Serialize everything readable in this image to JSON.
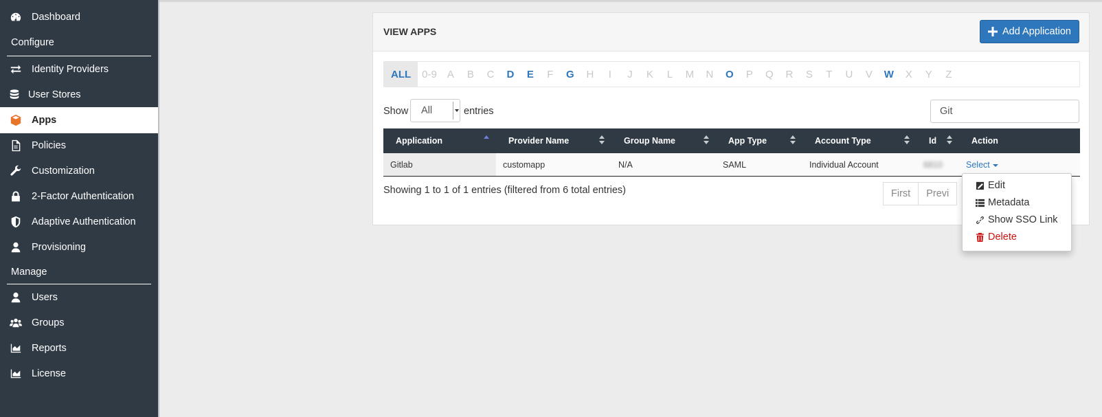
{
  "sidebar": {
    "items": [
      {
        "label": "Dashboard",
        "icon": "dashboard-icon"
      },
      {
        "label": "Identity Providers",
        "icon": "exchange-icon"
      },
      {
        "label": "User Stores",
        "icon": "database-icon"
      },
      {
        "label": "Apps",
        "icon": "cube-icon",
        "active": true
      },
      {
        "label": "Policies",
        "icon": "document-icon"
      },
      {
        "label": "Customization",
        "icon": "wrench-icon"
      },
      {
        "label": "2-Factor Authentication",
        "icon": "lock-icon"
      },
      {
        "label": "Adaptive Authentication",
        "icon": "shield-icon"
      },
      {
        "label": "Provisioning",
        "icon": "user-icon"
      },
      {
        "label": "Users",
        "icon": "user-icon"
      },
      {
        "label": "Groups",
        "icon": "users-icon"
      },
      {
        "label": "Reports",
        "icon": "area-chart-icon"
      },
      {
        "label": "License",
        "icon": "area-chart-icon"
      }
    ],
    "sections": {
      "configure": "Configure",
      "manage": "Manage"
    }
  },
  "panel": {
    "title": "VIEW APPS",
    "add_button": "Add Application",
    "alpha_filter": [
      "ALL",
      "0-9",
      "A",
      "B",
      "C",
      "D",
      "E",
      "F",
      "G",
      "H",
      "I",
      "J",
      "K",
      "L",
      "M",
      "N",
      "O",
      "P",
      "Q",
      "R",
      "S",
      "T",
      "U",
      "V",
      "W",
      "X",
      "Y",
      "Z"
    ],
    "alpha_active": [
      "ALL",
      "D",
      "E",
      "G",
      "O",
      "W"
    ],
    "show_label": "Show",
    "page_size": "All",
    "entries_label": "entries",
    "search_value": "Git",
    "columns": [
      "Application",
      "Provider Name",
      "Group Name",
      "App Type",
      "Account Type",
      "Id",
      "Action"
    ],
    "rows": [
      {
        "application": "Gitlab",
        "provider": "customapp",
        "group": "N/A",
        "app_type": "SAML",
        "account_type": "Individual Account",
        "id": "6810",
        "action": "Select"
      }
    ],
    "info": "Showing 1 to 1 of 1 entries (filtered from 6 total entries)",
    "pager": {
      "first": "First",
      "previous": "Previ"
    }
  },
  "dropdown": {
    "items": [
      {
        "label": "Edit",
        "icon": "edit-icon"
      },
      {
        "label": "Metadata",
        "icon": "list-icon"
      },
      {
        "label": "Show SSO Link",
        "icon": "link-icon"
      },
      {
        "label": "Delete",
        "icon": "trash-icon",
        "danger": true
      }
    ]
  },
  "colors": {
    "sidebar_bg": "#2f3a44",
    "accent": "#2e77bd",
    "active_icon": "#e8762a",
    "danger": "#cc1111"
  }
}
